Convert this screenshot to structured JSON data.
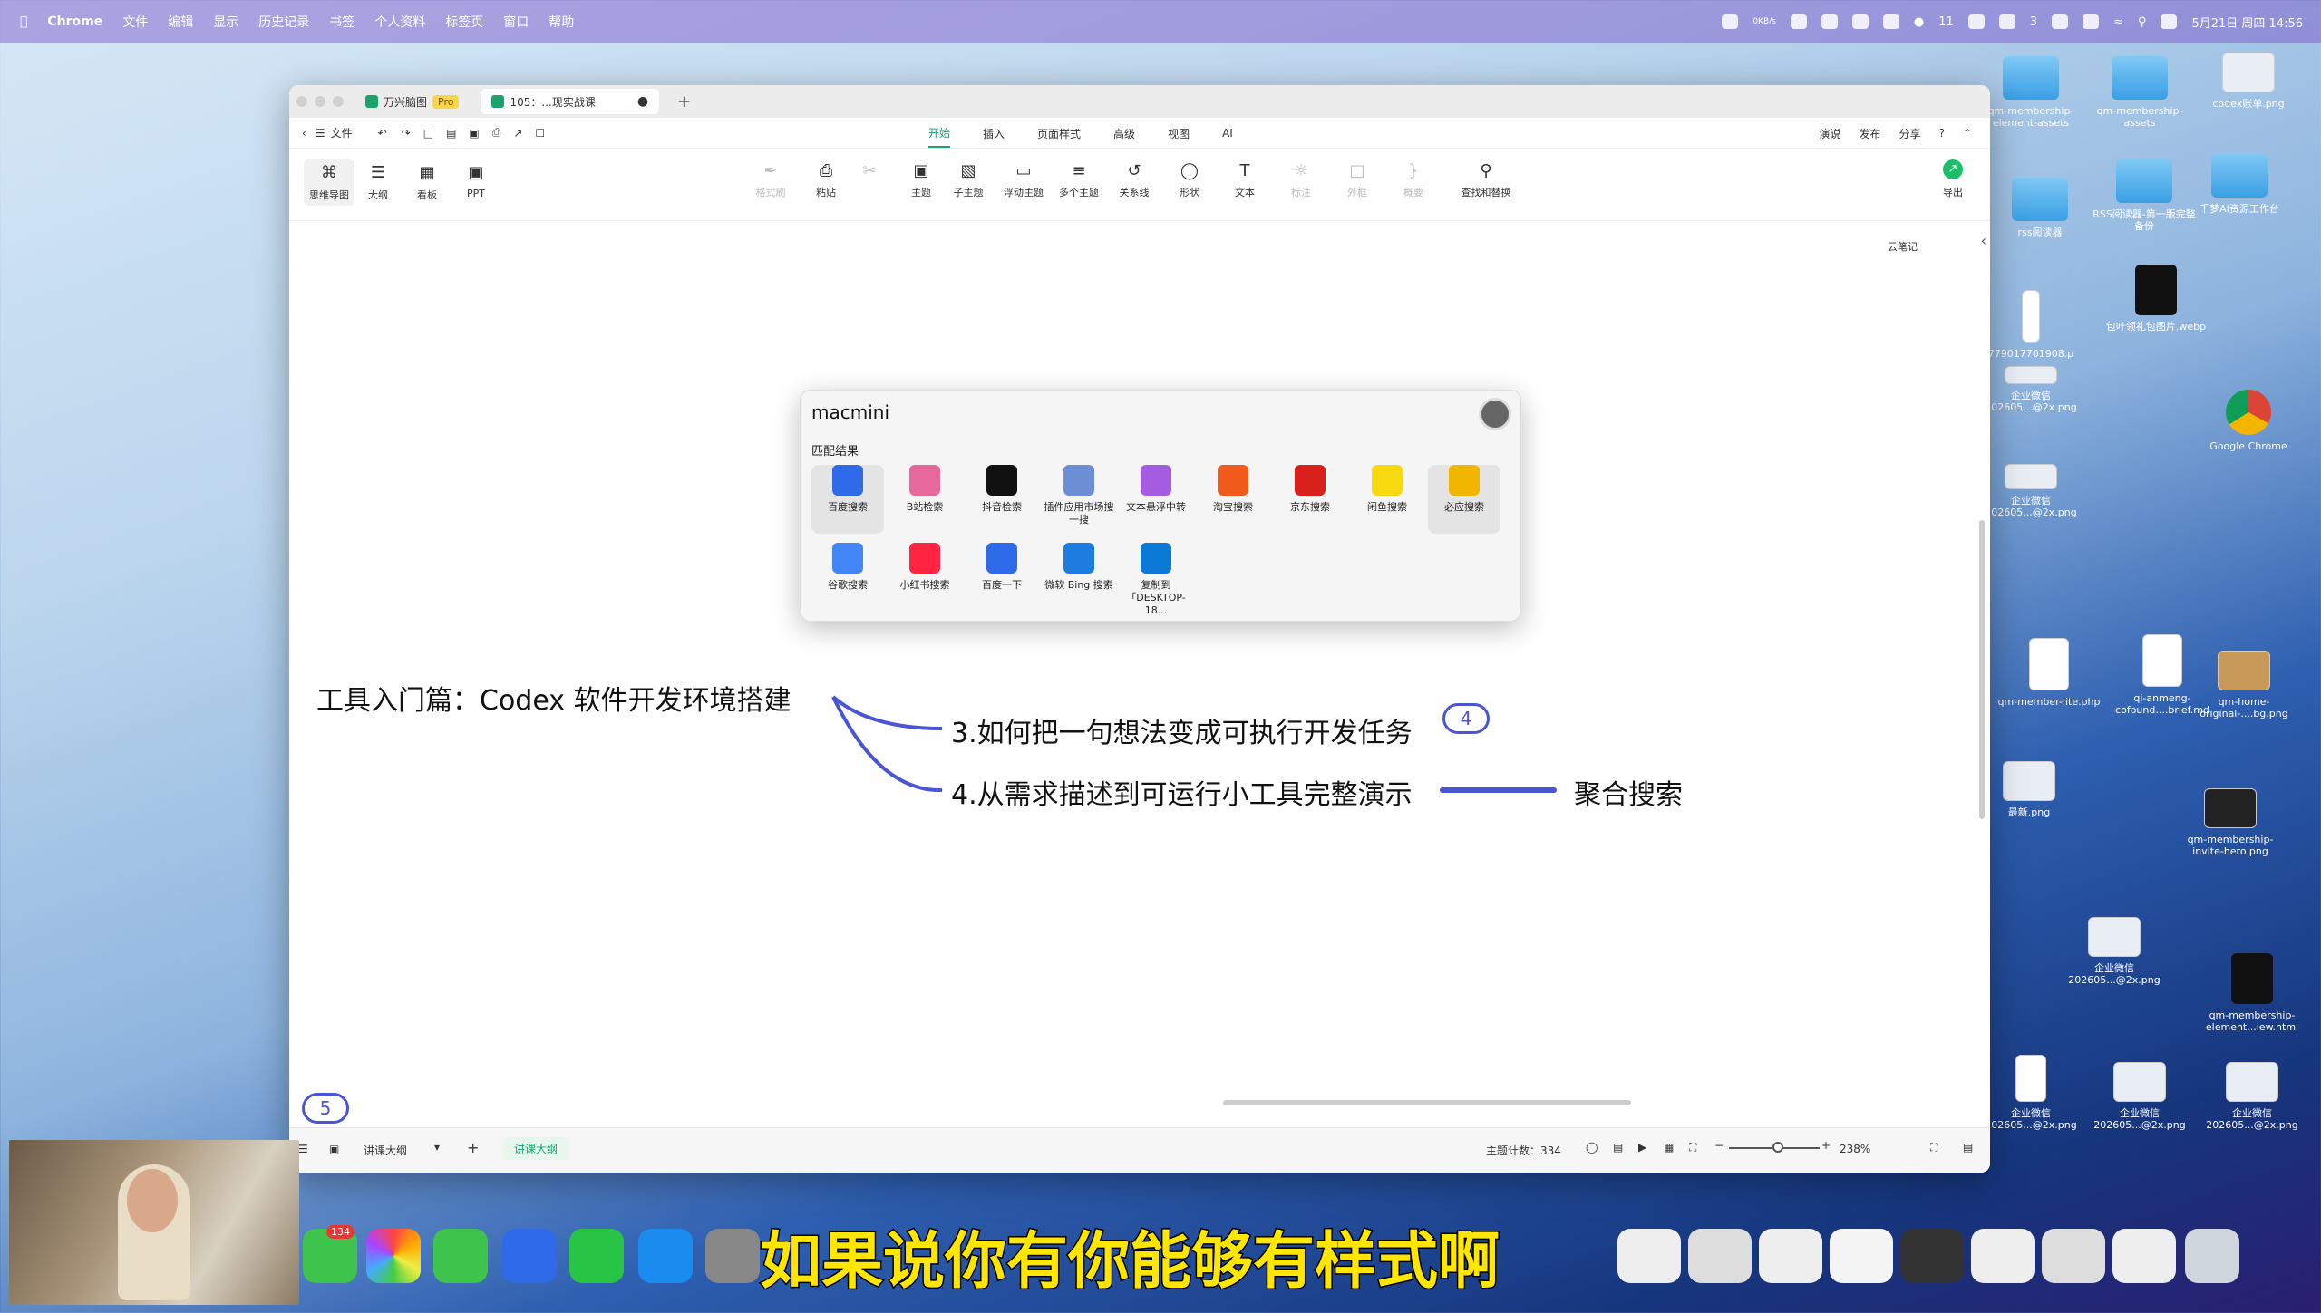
{
  "menubar": {
    "app": "Chrome",
    "items": [
      "文件",
      "编辑",
      "显示",
      "历史记录",
      "书签",
      "个人资料",
      "标签页",
      "窗口",
      "帮助"
    ],
    "network": "0KB/s",
    "wechat_count": "11",
    "other_count": "3",
    "datetime": "5月21日 周四 14:56"
  },
  "desktop": {
    "files": [
      {
        "label": "qm-membership-element-assets",
        "kind": "folder"
      },
      {
        "label": "qm-membership-assets",
        "kind": "folder"
      },
      {
        "label": "codex账单.png",
        "kind": "image"
      },
      {
        "label": "rss阅读器",
        "kind": "folder"
      },
      {
        "label": "RSS阅读器-第一版完整备份",
        "kind": "folder"
      },
      {
        "label": "千梦AI资源工作台",
        "kind": "folder"
      },
      {
        "label": "779017701908.p",
        "kind": "doc"
      },
      {
        "label": "包叶领礼包图片.webp",
        "kind": "image"
      },
      {
        "label": "企业微信202605...@2x.png",
        "kind": "image"
      },
      {
        "label": "Google Chrome",
        "kind": "app"
      },
      {
        "label": "企业微信202605...@2x.png",
        "kind": "image"
      },
      {
        "label": "qm-member-lite.php",
        "kind": "doc"
      },
      {
        "label": "qi-anmeng-cofound....brief.md",
        "kind": "doc"
      },
      {
        "label": "qm-home-original-....bg.png",
        "kind": "image"
      },
      {
        "label": "最新.png",
        "kind": "image"
      },
      {
        "label": "qm-membership-invite-hero.png",
        "kind": "image"
      },
      {
        "label": "企业微信202605...@2x.png",
        "kind": "image"
      },
      {
        "label": "qm-membership-element...iew.html",
        "kind": "doc"
      },
      {
        "label": "企业微信202605...@2x.png",
        "kind": "image"
      },
      {
        "label": "企业微信202605...@2x.png",
        "kind": "image"
      },
      {
        "label": "企业微信202605...@2x.png",
        "kind": "image"
      }
    ]
  },
  "window": {
    "tabs": [
      {
        "label": "万兴脑图",
        "badge": "Pro"
      },
      {
        "label": "105：...现实战课"
      }
    ],
    "toolbar": {
      "file": "文件"
    },
    "menu_tabs": [
      "开始",
      "插入",
      "页面样式",
      "高级",
      "视图",
      "AI"
    ],
    "right_actions": [
      "演说",
      "发布",
      "分享"
    ],
    "views": [
      "思维导图",
      "大纲",
      "看板",
      "PPT"
    ],
    "ribbon": [
      "格式刷",
      "粘贴",
      "主题",
      "子主题",
      "浮动主题",
      "多个主题",
      "关系线",
      "形状",
      "文本",
      "标注",
      "外框",
      "概要",
      "查找和替换"
    ],
    "export": "导出",
    "cloud_note": "云笔记"
  },
  "mindmap": {
    "root": "工具入门篇：Codex 软件开发环境搭建",
    "node3": "3.如何把一句想法变成可执行开发任务",
    "node3_badge": "4",
    "node4": "4.从需求描述到可运行小工具完整演示",
    "node4_child": "聚合搜索",
    "corner_badge": "5"
  },
  "popup": {
    "query": "macmini",
    "section": "匹配结果",
    "engines": [
      {
        "label": "百度搜索",
        "icon": "baidu-icon",
        "color": "#2f6be8"
      },
      {
        "label": "B站检索",
        "icon": "bilibili-icon",
        "color": "#e7689a"
      },
      {
        "label": "抖音检索",
        "icon": "douyin-icon",
        "color": "#111111"
      },
      {
        "label": "插件应用市场搜一搜",
        "icon": "plugin-market-icon",
        "color": "#6c8fd6"
      },
      {
        "label": "文本悬浮中转",
        "icon": "pin-icon",
        "color": "#a45ce0"
      },
      {
        "label": "淘宝搜索",
        "icon": "taobao-icon",
        "color": "#f05a1a"
      },
      {
        "label": "京东搜索",
        "icon": "jd-icon",
        "color": "#d9211c"
      },
      {
        "label": "闲鱼搜索",
        "icon": "xianyu-icon",
        "color": "#f8d90f"
      },
      {
        "label": "必应搜索",
        "icon": "bing-icon",
        "color": "#f2b600"
      },
      {
        "label": "谷歌搜索",
        "icon": "google-icon",
        "color": "#4285f4"
      },
      {
        "label": "小红书搜索",
        "icon": "xiaohongshu-icon",
        "color": "#ff2442"
      },
      {
        "label": "百度一下",
        "icon": "baidu-icon",
        "color": "#2f6be8"
      },
      {
        "label": "微软 Bing 搜索",
        "icon": "ms-bing-icon",
        "color": "#1c7ce0"
      },
      {
        "label": "复制到「DESKTOP-18...",
        "icon": "windows-icon",
        "color": "#0a7ad6"
      }
    ]
  },
  "statusbar": {
    "outline_tab": "讲课大纲",
    "active_tab": "讲课大纲",
    "topic_count": "主题计数：334",
    "zoom": "238%"
  },
  "dock": {
    "mail_badge": "134"
  },
  "subtitle": "如果说你有你能够有样式啊"
}
